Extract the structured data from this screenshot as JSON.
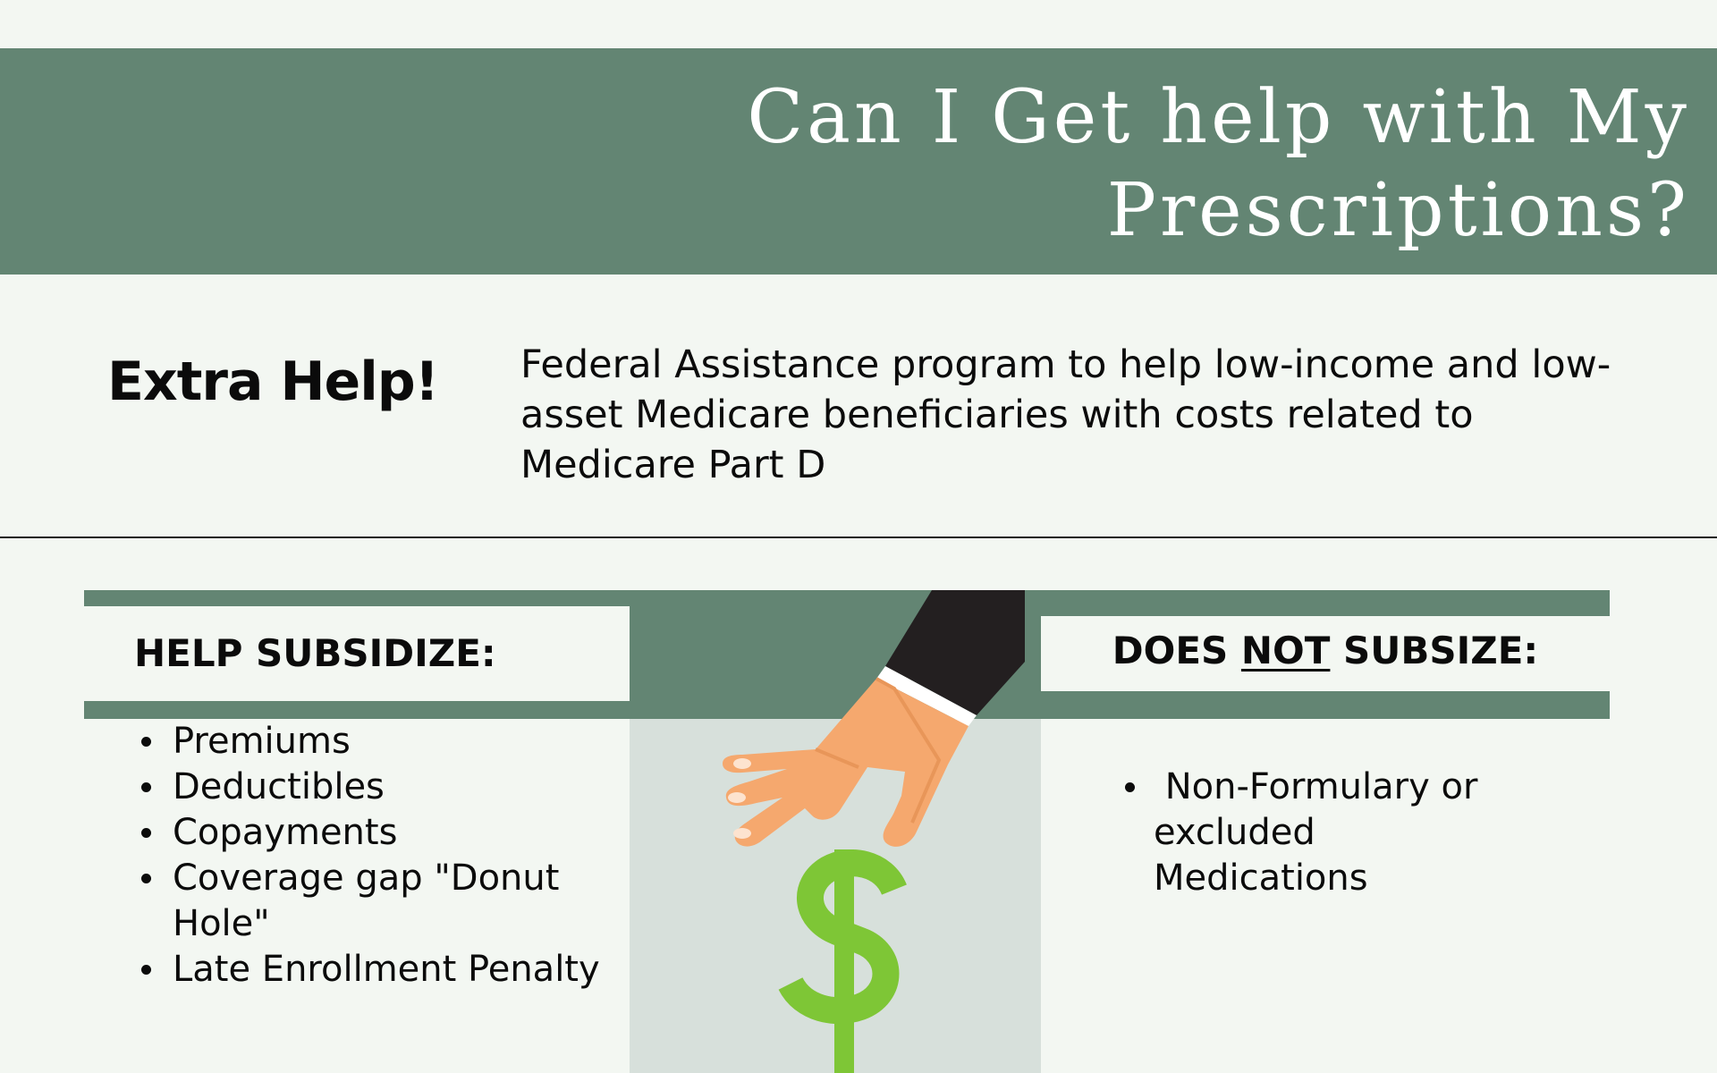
{
  "header": {
    "title_line1": "Can I Get help with My",
    "title_line2": "Prescriptions?"
  },
  "extra_help": {
    "heading": "Extra Help!",
    "description": "Federal Assistance program to help low-income and low-asset Medicare beneficiaries with costs related to Medicare Part D"
  },
  "help_subsidize": {
    "label": "HELP SUBSIDIZE:",
    "items": [
      "Premiums",
      "Deductibles",
      "Copayments",
      "Coverage gap \"Donut Hole\"",
      "Late Enrollment Penalty"
    ]
  },
  "does_not_subsidize": {
    "label_prefix": "DOES ",
    "label_emphasis": "NOT",
    "label_suffix": " SUBSIZE:",
    "items": [
      " Non-Formulary or excluded Medications"
    ]
  },
  "illustration": {
    "icon": "hand-holding-dollar-icon",
    "colors": {
      "sleeve": "#231f20",
      "cuff": "#ffffff",
      "skin": "#f5a86e",
      "dollar": "#7ec636"
    }
  },
  "colors": {
    "accent_green": "#638573",
    "panel_gray": "#d7e0db",
    "background": "#f3f7f2"
  }
}
